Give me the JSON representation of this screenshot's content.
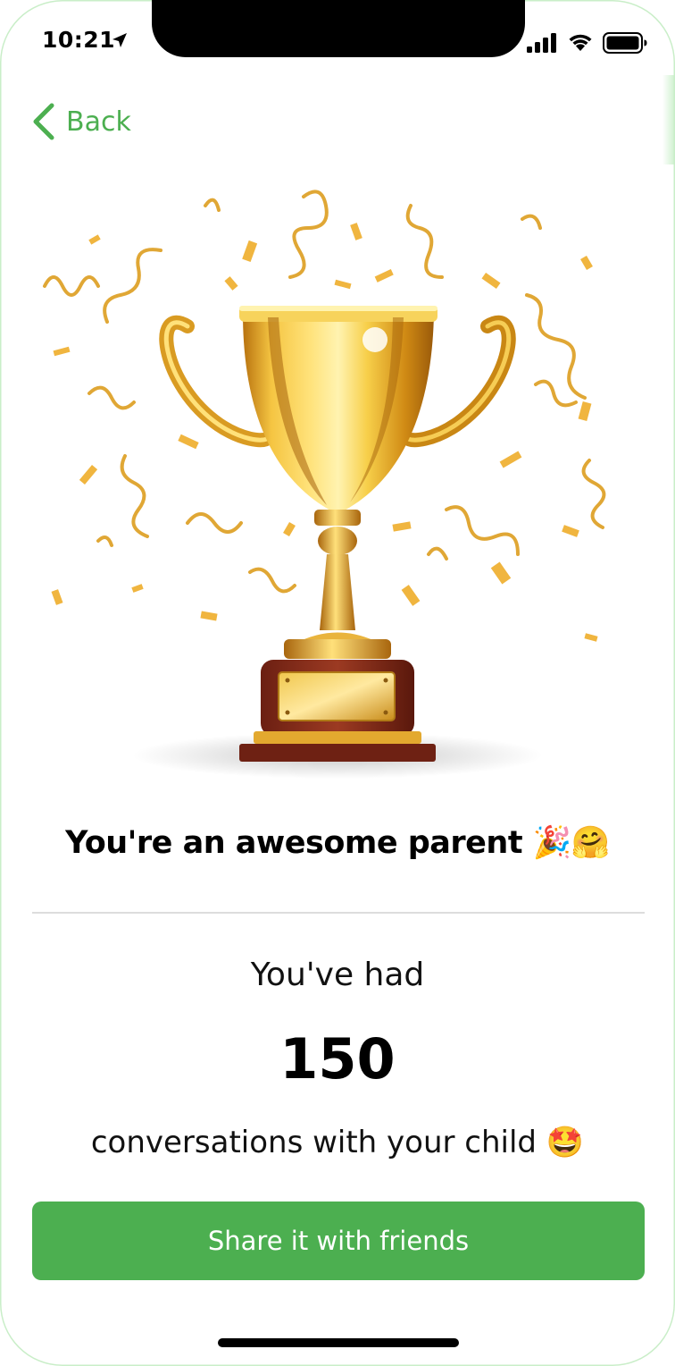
{
  "status_bar": {
    "time": "10:21",
    "icons": [
      "location-arrow-icon",
      "cellular-signal-icon",
      "wifi-icon",
      "battery-icon"
    ]
  },
  "nav": {
    "back_label": "Back",
    "back_icon": "chevron-left-icon"
  },
  "hero": {
    "image": "gold-trophy-with-confetti"
  },
  "content": {
    "headline": "You're an awesome parent 🎉🤗",
    "stat_prefix": "You've had",
    "stat_value": "150",
    "stat_suffix": "conversations with your child 🤩"
  },
  "actions": {
    "share_label": "Share it with friends"
  },
  "colors": {
    "accent": "#4caf50",
    "text": "#000000",
    "divider": "#dddddd",
    "background": "#ffffff"
  }
}
